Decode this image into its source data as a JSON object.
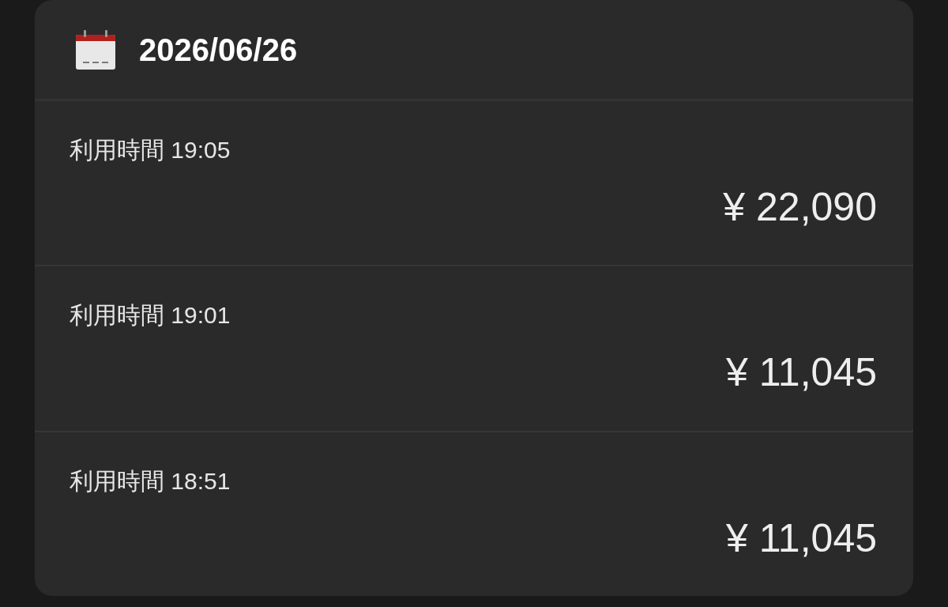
{
  "header": {
    "date": "2026/06/26"
  },
  "entries": [
    {
      "time": "利用時間 19:05",
      "amount": "¥ 22,090"
    },
    {
      "time": "利用時間 19:01",
      "amount": "¥ 11,045"
    },
    {
      "time": "利用時間 18:51",
      "amount": "¥ 11,045"
    }
  ]
}
